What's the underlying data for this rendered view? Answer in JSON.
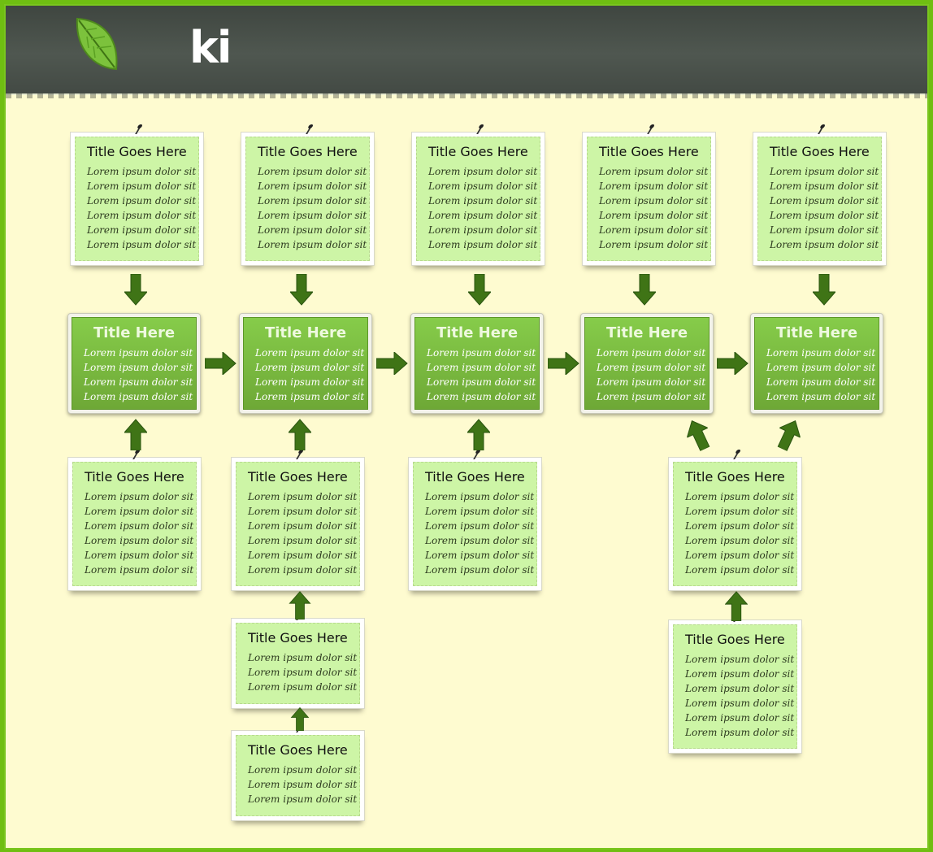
{
  "brand": {
    "name": "ki",
    "logo_icon": "leaf-icon",
    "accent": "#6fbe12"
  },
  "hubs": [
    {
      "title": "Title Here",
      "lines": [
        "Lorem ipsum dolor sit",
        "Lorem ipsum dolor sit",
        "Lorem ipsum dolor sit",
        "Lorem ipsum dolor sit"
      ]
    },
    {
      "title": "Title Here",
      "lines": [
        "Lorem ipsum dolor sit",
        "Lorem ipsum dolor sit",
        "Lorem ipsum dolor sit",
        "Lorem ipsum dolor sit"
      ]
    },
    {
      "title": "Title Here",
      "lines": [
        "Lorem ipsum dolor sit",
        "Lorem ipsum dolor sit",
        "Lorem ipsum dolor sit",
        "Lorem ipsum dolor sit"
      ]
    },
    {
      "title": "Title Here",
      "lines": [
        "Lorem ipsum dolor sit",
        "Lorem ipsum dolor sit",
        "Lorem ipsum dolor sit",
        "Lorem ipsum dolor sit"
      ]
    },
    {
      "title": "Title Here",
      "lines": [
        "Lorem ipsum dolor sit",
        "Lorem ipsum dolor sit",
        "Lorem ipsum dolor sit",
        "Lorem ipsum dolor sit"
      ]
    }
  ],
  "top_notes": [
    {
      "title": "Title Goes Here",
      "lines": [
        "Lorem ipsum dolor sit",
        "Lorem ipsum dolor sit",
        "Lorem ipsum dolor sit",
        "Lorem ipsum dolor sit",
        "Lorem ipsum dolor sit",
        "Lorem ipsum dolor sit"
      ]
    },
    {
      "title": "Title Goes Here",
      "lines": [
        "Lorem ipsum dolor sit",
        "Lorem ipsum dolor sit",
        "Lorem ipsum dolor sit",
        "Lorem ipsum dolor sit",
        "Lorem ipsum dolor sit",
        "Lorem ipsum dolor sit"
      ]
    },
    {
      "title": "Title Goes Here",
      "lines": [
        "Lorem ipsum dolor sit",
        "Lorem ipsum dolor sit",
        "Lorem ipsum dolor sit",
        "Lorem ipsum dolor sit",
        "Lorem ipsum dolor sit",
        "Lorem ipsum dolor sit"
      ]
    },
    {
      "title": "Title Goes Here",
      "lines": [
        "Lorem ipsum dolor sit",
        "Lorem ipsum dolor sit",
        "Lorem ipsum dolor sit",
        "Lorem ipsum dolor sit",
        "Lorem ipsum dolor sit",
        "Lorem ipsum dolor sit"
      ]
    },
    {
      "title": "Title Goes Here",
      "lines": [
        "Lorem ipsum dolor sit",
        "Lorem ipsum dolor sit",
        "Lorem ipsum dolor sit",
        "Lorem ipsum dolor sit",
        "Lorem ipsum dolor sit",
        "Lorem ipsum dolor sit"
      ]
    }
  ],
  "bottom_notes": [
    {
      "title": "Title Goes Here",
      "lines": [
        "Lorem ipsum dolor sit",
        "Lorem ipsum dolor sit",
        "Lorem ipsum dolor sit",
        "Lorem ipsum dolor sit",
        "Lorem ipsum dolor sit",
        "Lorem ipsum dolor sit"
      ]
    },
    {
      "title": "Title Goes Here",
      "lines": [
        "Lorem ipsum dolor sit",
        "Lorem ipsum dolor sit",
        "Lorem ipsum dolor sit",
        "Lorem ipsum dolor sit",
        "Lorem ipsum dolor sit",
        "Lorem ipsum dolor sit"
      ]
    },
    {
      "title": "Title Goes Here",
      "lines": [
        "Lorem ipsum dolor sit",
        "Lorem ipsum dolor sit",
        "Lorem ipsum dolor sit"
      ]
    },
    {
      "title": "Title Goes Here",
      "lines": [
        "Lorem ipsum dolor sit",
        "Lorem ipsum dolor sit",
        "Lorem ipsum dolor sit"
      ]
    },
    {
      "title": "Title Goes Here",
      "lines": [
        "Lorem ipsum dolor sit",
        "Lorem ipsum dolor sit",
        "Lorem ipsum dolor sit",
        "Lorem ipsum dolor sit",
        "Lorem ipsum dolor sit",
        "Lorem ipsum dolor sit"
      ]
    },
    {
      "title": "Title Goes Here",
      "lines": [
        "Lorem ipsum dolor sit",
        "Lorem ipsum dolor sit",
        "Lorem ipsum dolor sit",
        "Lorem ipsum dolor sit",
        "Lorem ipsum dolor sit",
        "Lorem ipsum dolor sit"
      ]
    },
    {
      "title": "Title Goes Here",
      "lines": [
        "Lorem ipsum dolor sit",
        "Lorem ipsum dolor sit",
        "Lorem ipsum dolor sit",
        "Lorem ipsum dolor sit",
        "Lorem ipsum dolor sit",
        "Lorem ipsum dolor sit"
      ]
    }
  ]
}
